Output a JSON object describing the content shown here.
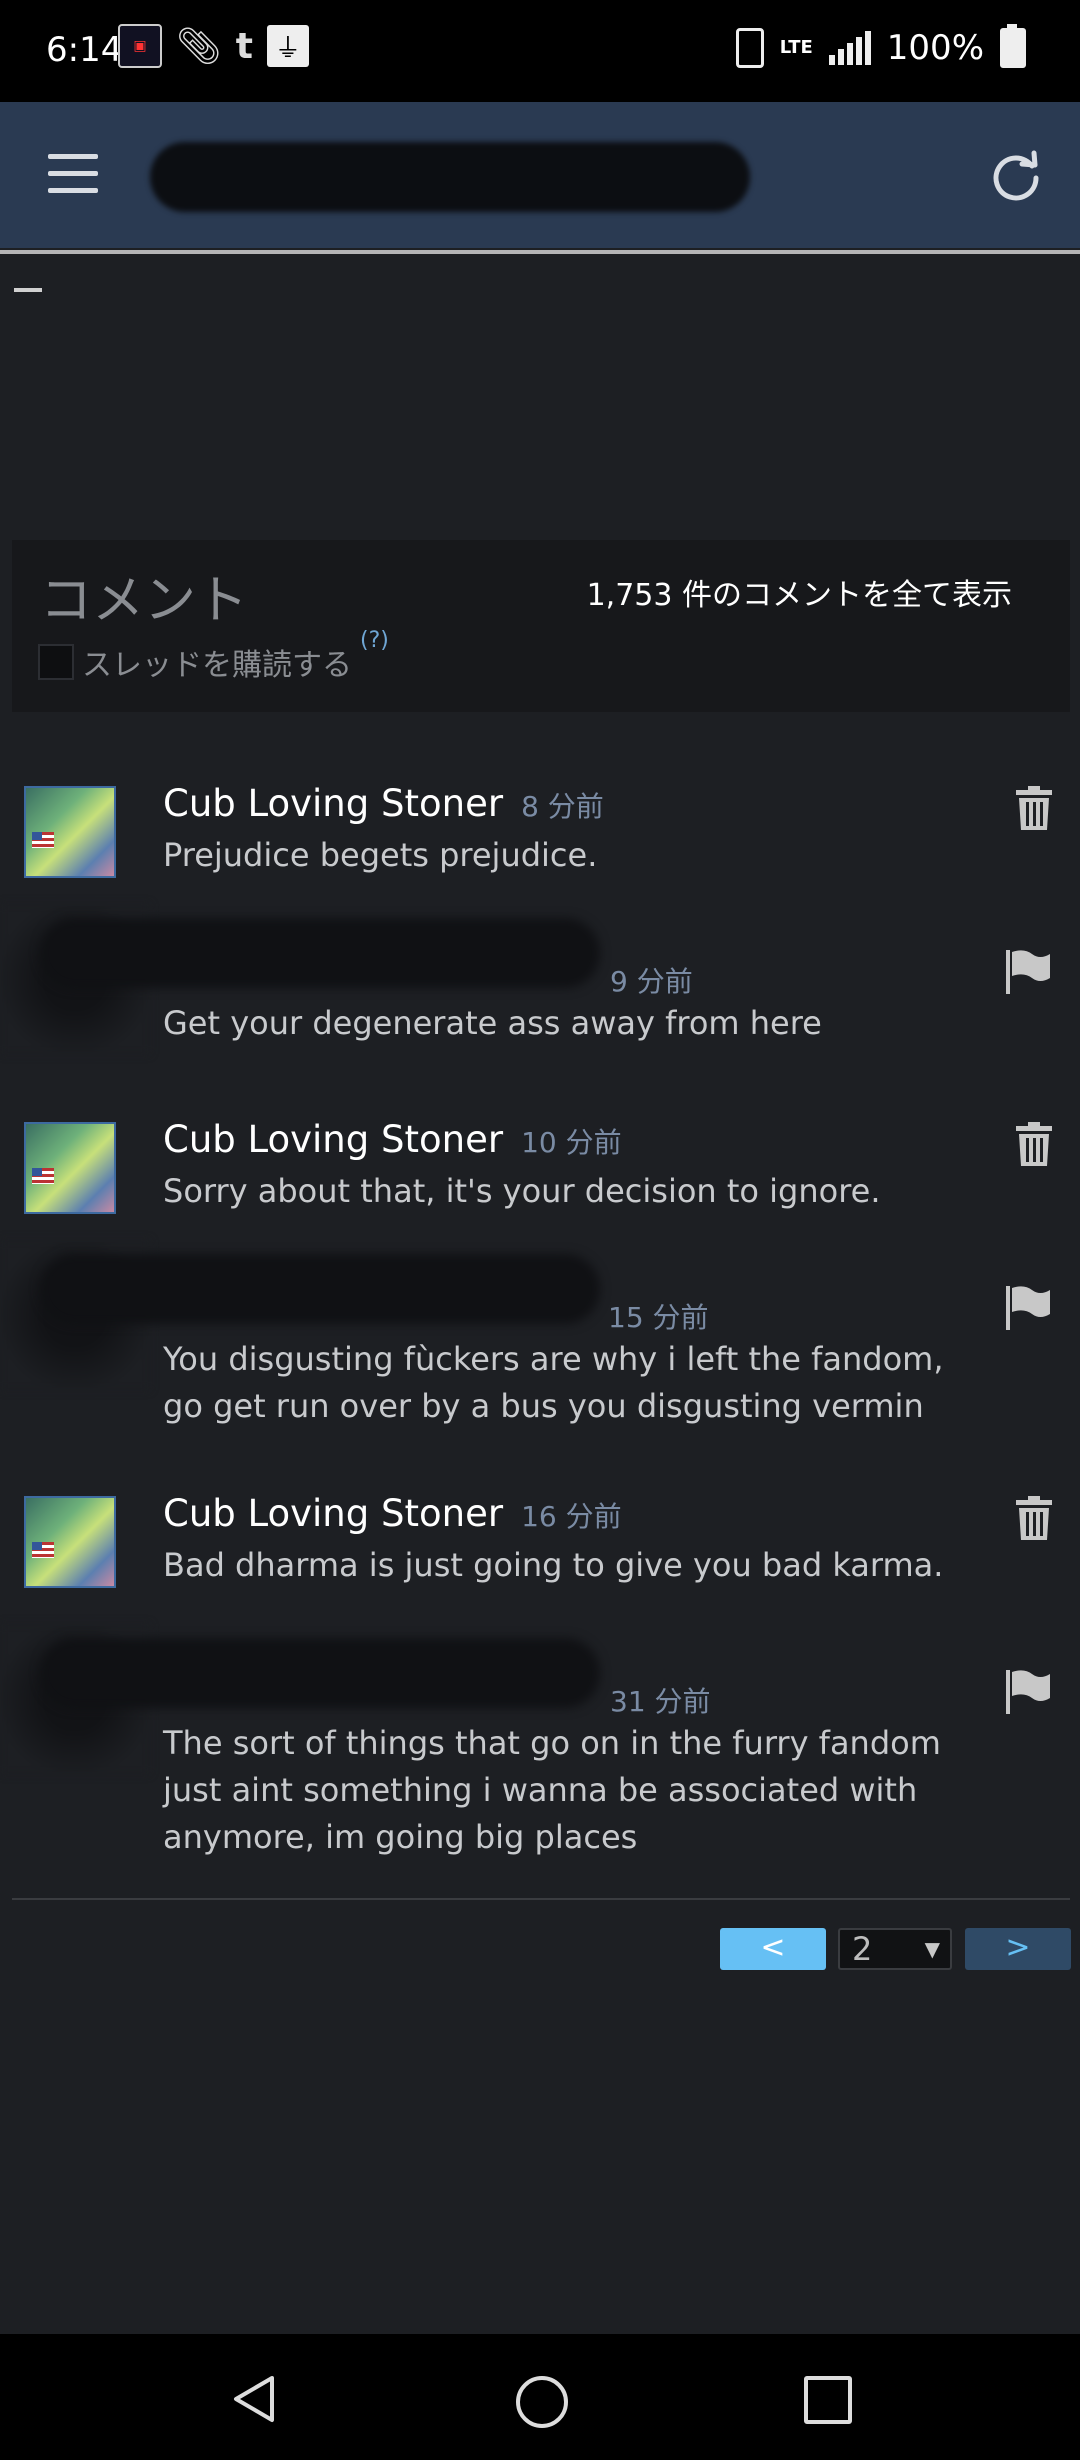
{
  "status_bar": {
    "time": "6:14",
    "icons": [
      "notification-app-icon",
      "paperclip-icon",
      "tumblr-icon",
      "usb-icon"
    ],
    "tumblr_glyph": "t",
    "network": "LTE",
    "battery": "100%"
  },
  "header": {
    "menu_icon": "hamburger-menu-icon",
    "refresh_icon": "refresh-icon"
  },
  "comments_section": {
    "title": "コメント",
    "view_all": "1,753 件のコメントを全て表示",
    "subscribe_label": "スレッドを購読する",
    "help": "(?)"
  },
  "comments": [
    {
      "author": "Cub Loving Stoner",
      "time": "8 分前",
      "text": "Prejudice begets prejudice.",
      "action": "delete"
    },
    {
      "author": "",
      "time": "9 分前",
      "text": "Get your degenerate ass away from here",
      "action": "report"
    },
    {
      "author": "Cub Loving Stoner",
      "time": "10 分前",
      "text": "Sorry about that, it's your decision to ignore.",
      "action": "delete"
    },
    {
      "author": "",
      "time": "15 分前",
      "text": "You disgusting fùckers are why i left the fandom, go get run over by a bus you disgusting vermin",
      "action": "report"
    },
    {
      "author": "Cub Loving Stoner",
      "time": "16 分前",
      "text": "Bad dharma is just going to give you bad karma.",
      "action": "delete"
    },
    {
      "author": "",
      "time": "31 分前",
      "text": "The sort of things that go on in the furry fandom just aint something i wanna be associated with anymore, im going big places",
      "action": "report"
    }
  ],
  "pagination": {
    "prev_label": "<",
    "current_page": "2",
    "next_label": ">"
  },
  "colors": {
    "header_bg": "#2a3a52",
    "accent": "#66c0f4",
    "timestamp": "#7a8ba4"
  }
}
